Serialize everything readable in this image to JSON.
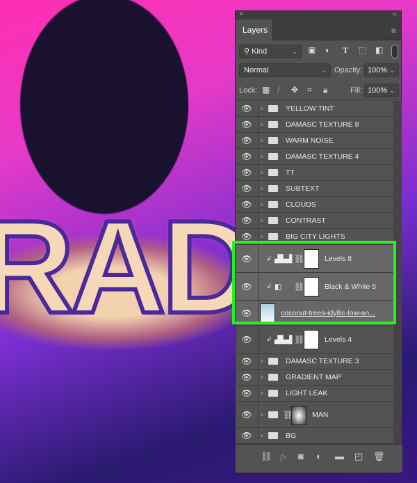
{
  "canvas": {
    "art_text": "RAD"
  },
  "panel": {
    "close": "×",
    "collapse": "‹‹",
    "tab": "Layers",
    "menu_icon": "hamburger-icon",
    "filter": {
      "label": "Kind",
      "icons": [
        "image-filter",
        "adjustment-filter",
        "type-filter",
        "shape-filter",
        "smart-object-filter"
      ]
    },
    "blend_mode": "Normal",
    "opacity_label": "Opacity:",
    "opacity": "100%",
    "lock_label": "Lock:",
    "fill_label": "Fill:",
    "fill": "100%"
  },
  "layers": [
    {
      "name": "YELLOW TINT",
      "type": "group"
    },
    {
      "name": "DAMASC TEXTURE 8",
      "type": "group"
    },
    {
      "name": "WARM NOISE",
      "type": "group"
    },
    {
      "name": "DAMASC TEXTURE 4",
      "type": "group"
    },
    {
      "name": "TT",
      "type": "group"
    },
    {
      "name": "SUBTEXT",
      "type": "group"
    },
    {
      "name": "CLOUDS",
      "type": "group"
    },
    {
      "name": "CONTRAST",
      "type": "group"
    },
    {
      "name": "BIG CITY LIGHTS",
      "type": "group"
    },
    {
      "name": "Levels 8",
      "type": "levels"
    },
    {
      "name": "Black & White 5",
      "type": "bw"
    },
    {
      "name": "coconut-trees-idyllic-low-an...",
      "type": "smart"
    },
    {
      "name": "Levels 4",
      "type": "levels"
    },
    {
      "name": "DAMASC TEXTURE 3",
      "type": "group"
    },
    {
      "name": "GRADIENT MAP",
      "type": "group"
    },
    {
      "name": "LIGHT LEAK",
      "type": "group"
    },
    {
      "name": "MAN",
      "type": "group-mask"
    },
    {
      "name": "BG",
      "type": "group"
    }
  ],
  "highlight_color": "#22f422",
  "footer_icons": [
    "link-icon",
    "fx-icon",
    "mask-icon",
    "adjustment-icon",
    "folder-icon",
    "new-layer-icon",
    "trash-icon"
  ]
}
